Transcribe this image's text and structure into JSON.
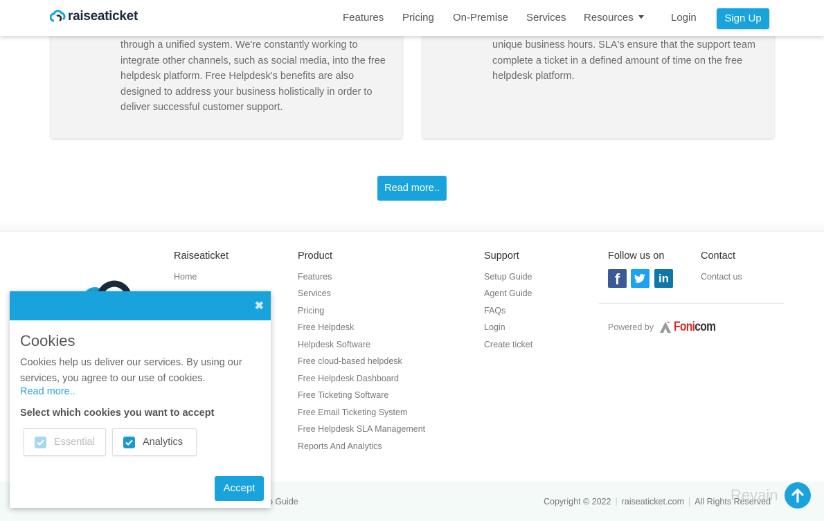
{
  "header": {
    "brand": "raiseaticket",
    "nav": [
      {
        "label": "Features"
      },
      {
        "label": "Pricing"
      },
      {
        "label": "On-Premise"
      },
      {
        "label": "Services"
      },
      {
        "label": "Resources"
      }
    ],
    "login_label": "Login",
    "signup_label": "Sign Up"
  },
  "cards": [
    {
      "text": "through a unified system. We're constantly working to integrate other channels, such as social media, into the free helpdesk platform. Free Helpdesk's benefits are also designed to address your business holistically in order to deliver successful customer support."
    },
    {
      "text": "unique business hours. SLA's ensure that the support team complete a ticket in a defined amount of time on the free helpdesk platform."
    }
  ],
  "read_more_button": "Read more..",
  "footer": {
    "columns": [
      {
        "title": "Raiseaticket",
        "links": [
          "Home"
        ]
      },
      {
        "title": "Product",
        "links": [
          "Features",
          "Services",
          "Pricing",
          "Free Helpdesk",
          "Helpdesk Software",
          "Free cloud-based helpdesk",
          "Free Helpdesk Dashboard",
          "Free Ticketing Software",
          "Free Email Ticketing System",
          "Free Helpdesk SLA Management",
          "Reports And Analytics"
        ]
      },
      {
        "title": "Support",
        "links": [
          "Setup Guide",
          "Agent Guide",
          "FAQs",
          "Login",
          "Create ticket"
        ]
      },
      {
        "title": "Follow us on",
        "links": []
      },
      {
        "title": "Contact",
        "links": [
          "Contact us"
        ]
      }
    ],
    "social": [
      {
        "name": "facebook",
        "glyph": "f",
        "color": "#3b5998"
      },
      {
        "name": "twitter",
        "glyph": "t",
        "color": "#1da1f2"
      },
      {
        "name": "linkedin",
        "glyph": "in",
        "color": "#0e76a8"
      }
    ],
    "powered_by": "Powered by",
    "powered_brand_a": "Foni",
    "powered_brand_b": "com",
    "bottom_left": "up Guide",
    "copyright": "Copyright © 2022",
    "domain": "raiseaticket.com",
    "rights": "All Rights Reserved"
  },
  "cookie_dialog": {
    "title": "Cookies",
    "text": "Cookies help us deliver our services. By using our services, you agree to our use of cookies.",
    "read_more": "Read more..",
    "select_label": "Select which cookies you want to accept",
    "options": [
      {
        "label": "Essential",
        "checked": true,
        "disabled": true
      },
      {
        "label": "Analytics",
        "checked": true,
        "disabled": false
      }
    ],
    "accept_label": "Accept",
    "close_glyph": "✖"
  },
  "watermark": "Revain",
  "colors": {
    "accent": "#19a3dc",
    "brand_dark": "#1b2a3a",
    "footer_bottom_bg": "#f3faf8"
  }
}
